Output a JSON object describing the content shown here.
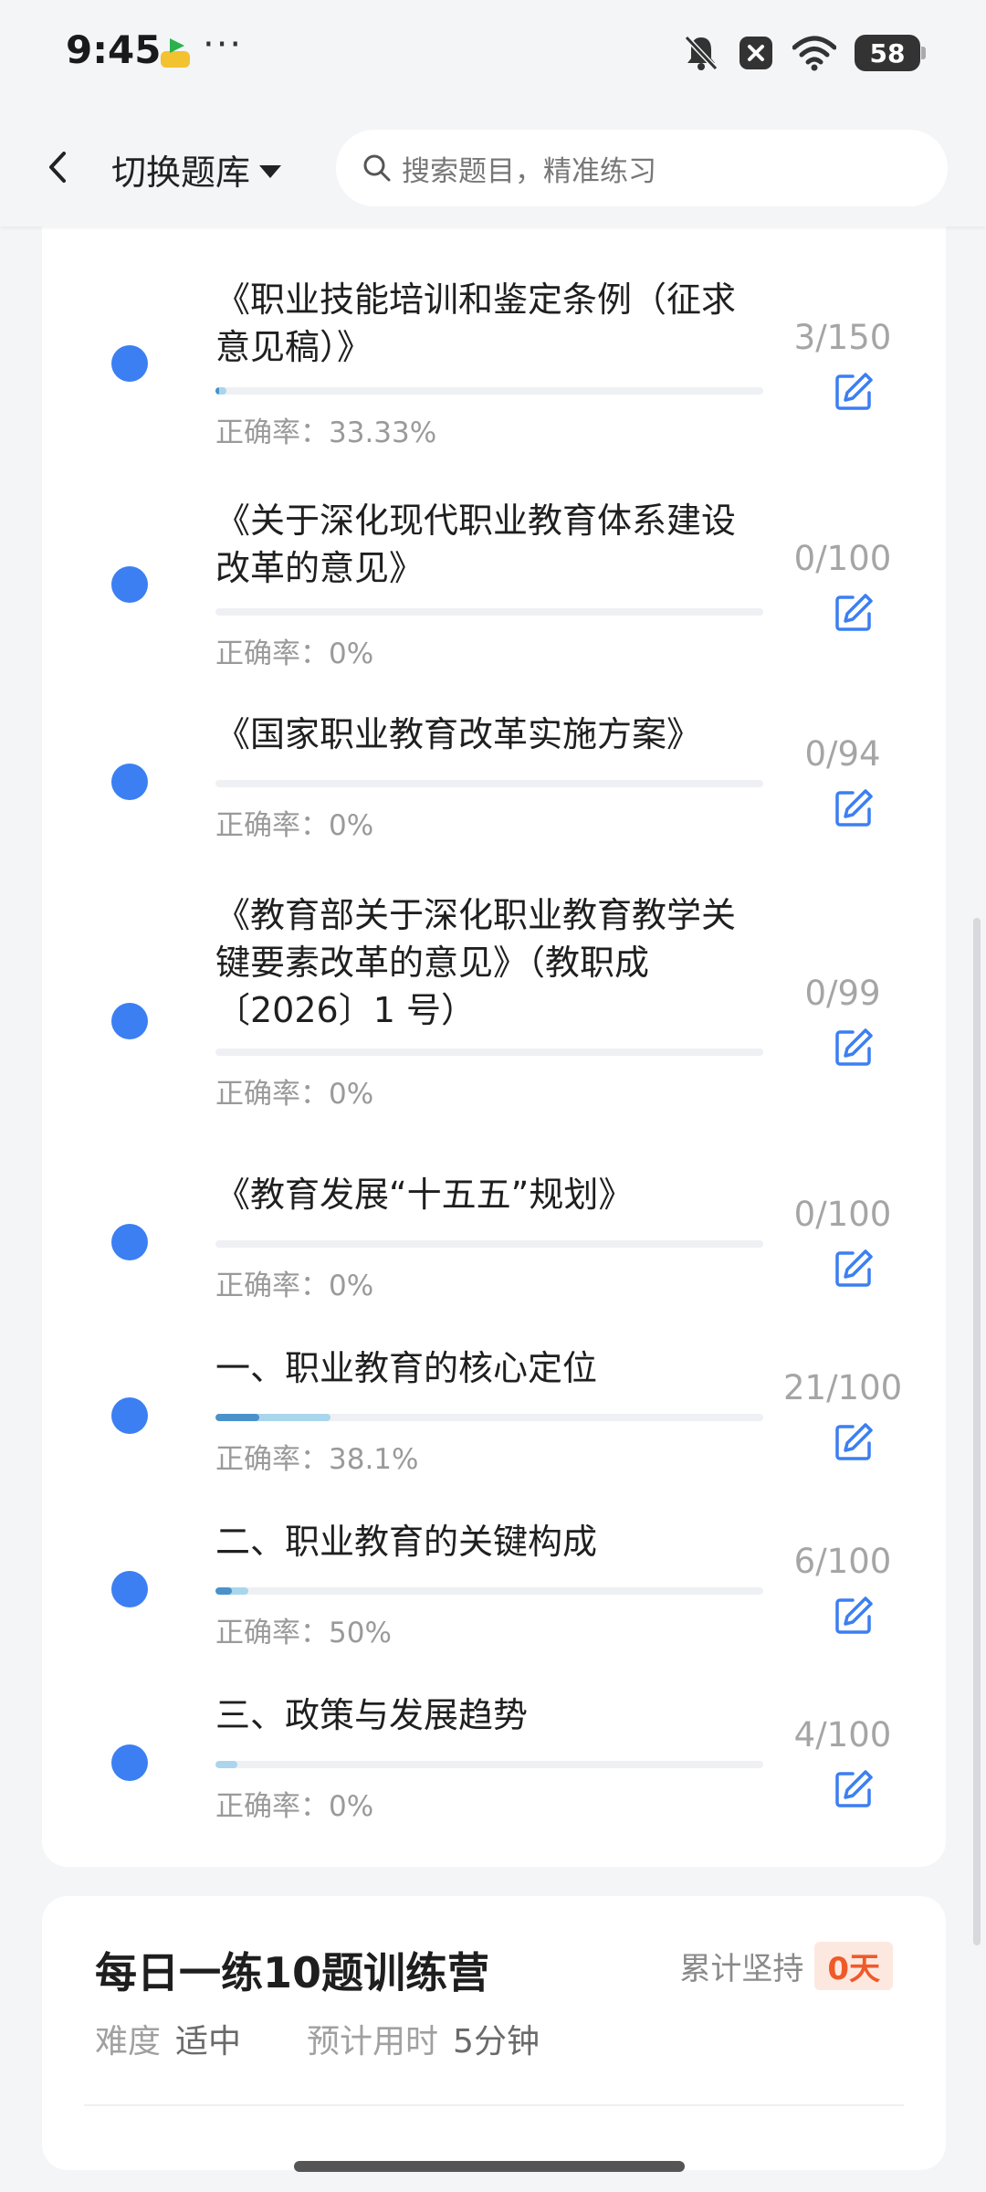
{
  "status_bar": {
    "time": "9:45",
    "more": "···",
    "battery": "58",
    "icons": [
      "app-badge-icon",
      "mute-bell-icon",
      "close-box-icon",
      "wifi-icon",
      "battery-icon"
    ]
  },
  "header": {
    "switch_label": "切换题库",
    "search_placeholder": "搜索题目，精准练习"
  },
  "chapters": [
    {
      "title": "《职业技能培训和鉴定条例（征求意见稿）》",
      "done": 3,
      "total": 150,
      "count": "3/150",
      "rate_label": "正确率：",
      "rate": "33.33%",
      "rate_value": 0.3333
    },
    {
      "title": "《关于深化现代职业教育体系建设改革的意见》",
      "done": 0,
      "total": 100,
      "count": "0/100",
      "rate_label": "正确率：",
      "rate": "0%",
      "rate_value": 0
    },
    {
      "title": "《国家职业教育改革实施方案》",
      "done": 0,
      "total": 94,
      "count": "0/94",
      "rate_label": "正确率：",
      "rate": "0%",
      "rate_value": 0
    },
    {
      "title": "《教育部关于深化职业教育教学关键要素改革的意见》（教职成〔2026〕1 号）",
      "done": 0,
      "total": 99,
      "count": "0/99",
      "rate_label": "正确率：",
      "rate": "0%",
      "rate_value": 0
    },
    {
      "title": "《教育发展“十五五”规划》",
      "done": 0,
      "total": 100,
      "count": "0/100",
      "rate_label": "正确率：",
      "rate": "0%",
      "rate_value": 0
    },
    {
      "title": "一、职业教育的核心定位",
      "done": 21,
      "total": 100,
      "count": "21/100",
      "rate_label": "正确率：",
      "rate": "38.1%",
      "rate_value": 0.381
    },
    {
      "title": "二、职业教育的关键构成",
      "done": 6,
      "total": 100,
      "count": "6/100",
      "rate_label": "正确率：",
      "rate": "50%",
      "rate_value": 0.5
    },
    {
      "title": "三、政策与发展趋势",
      "done": 4,
      "total": 100,
      "count": "4/100",
      "rate_label": "正确率：",
      "rate": "0%",
      "rate_value": 0
    }
  ],
  "camp": {
    "title": "每日一练10题训练营",
    "persist_label": "累计坚持",
    "persist_days": "0天",
    "difficulty_label": "难度",
    "difficulty_value": "适中",
    "time_label": "预计用时",
    "time_value": "5分钟"
  },
  "colors": {
    "accent": "#3b7ff2",
    "bar_done": "#a9d6ec",
    "bar_correct": "#4a92c9",
    "badge_text": "#ef5a2a",
    "badge_bg": "#fde8e0"
  }
}
